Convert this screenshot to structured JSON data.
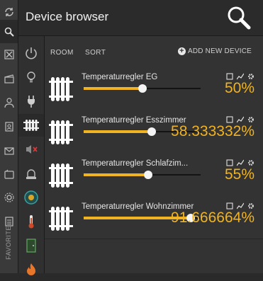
{
  "app": {
    "title": "Device browser"
  },
  "toolbar": {
    "room_label": "ROOM",
    "sort_label": "SORT",
    "add_device_label": "ADD NEW DEVICE"
  },
  "sidebar": {
    "favorite_label": "FAVORITE",
    "items": [
      {
        "icon": "refresh-icon"
      },
      {
        "icon": "search-icon",
        "active": true
      },
      {
        "icon": "tools-icon"
      },
      {
        "icon": "clapperboard-icon"
      },
      {
        "icon": "users-icon"
      },
      {
        "icon": "contacts-icon"
      },
      {
        "icon": "mail-icon"
      },
      {
        "icon": "device-icon"
      },
      {
        "icon": "settings-icon"
      },
      {
        "icon": "clipboard-icon"
      }
    ]
  },
  "categories": [
    {
      "icon": "power-icon"
    },
    {
      "icon": "lightbulb-icon"
    },
    {
      "icon": "plug-icon"
    },
    {
      "icon": "radiator-icon",
      "active": true
    },
    {
      "icon": "speaker-muted-icon"
    },
    {
      "icon": "alarm-light-icon"
    },
    {
      "icon": "gauge-icon"
    },
    {
      "icon": "thermometer-icon"
    },
    {
      "icon": "door-icon"
    },
    {
      "icon": "fire-icon"
    }
  ],
  "devices": [
    {
      "name": "Temperaturregler EG",
      "value_text": "50%",
      "level": 50
    },
    {
      "name": "Temperaturregler Esszimmer",
      "value_text": "58.333332%",
      "level": 58.333332
    },
    {
      "name": "Temperaturregler Schlafzim...",
      "value_text": "55%",
      "level": 55
    },
    {
      "name": "Temperaturregler Wohnzimmer",
      "value_text": "91.666664%",
      "level": 91.666664
    }
  ],
  "colors": {
    "accent": "#f0b323",
    "background": "#333333",
    "sidebar": "#3a3a3a"
  }
}
